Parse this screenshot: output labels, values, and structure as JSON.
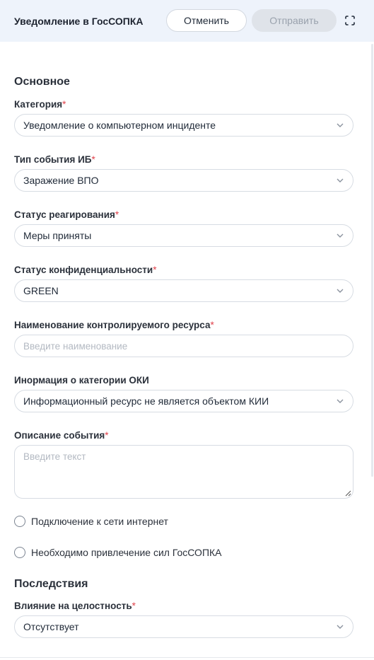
{
  "header": {
    "title": "Уведомление в ГосСОПКА",
    "cancel_label": "Отменить",
    "send_label": "Отправить"
  },
  "sections": {
    "main": "Основное",
    "consequences": "Последствия"
  },
  "fields": {
    "category": {
      "label": "Категория",
      "required": "*",
      "value": "Уведомление о компьютерном инциденте"
    },
    "event_type": {
      "label": "Тип события ИБ",
      "required": "*",
      "value": "Заражение ВПО"
    },
    "response_status": {
      "label": "Статус реагирования",
      "required": "*",
      "value": "Меры приняты"
    },
    "confidentiality": {
      "label": "Статус конфиденциальности",
      "required": "*",
      "value": "GREEN"
    },
    "resource_name": {
      "label": "Наименование контролируемого ресурса",
      "required": "*",
      "placeholder": "Введите наименование"
    },
    "oki_info": {
      "label": "Инормация о категории ОКИ",
      "value": "Информационный ресурс не является объектом КИИ"
    },
    "description": {
      "label": "Описание события",
      "required": "*",
      "placeholder": "Введите текст"
    },
    "integrity": {
      "label": "Влияние на целостность",
      "required": "*",
      "value": "Отсутствует"
    }
  },
  "checkboxes": {
    "internet": {
      "label": "Подключение к сети интернет",
      "checked": false
    },
    "gossopka": {
      "label": "Необходимо привлечение сил ГосСОПКА",
      "checked": false
    }
  },
  "colors": {
    "header_bg": "#eef3fb",
    "required": "#e0424b",
    "border": "#d7dce3",
    "disabled_btn": "#dfe3e9"
  }
}
